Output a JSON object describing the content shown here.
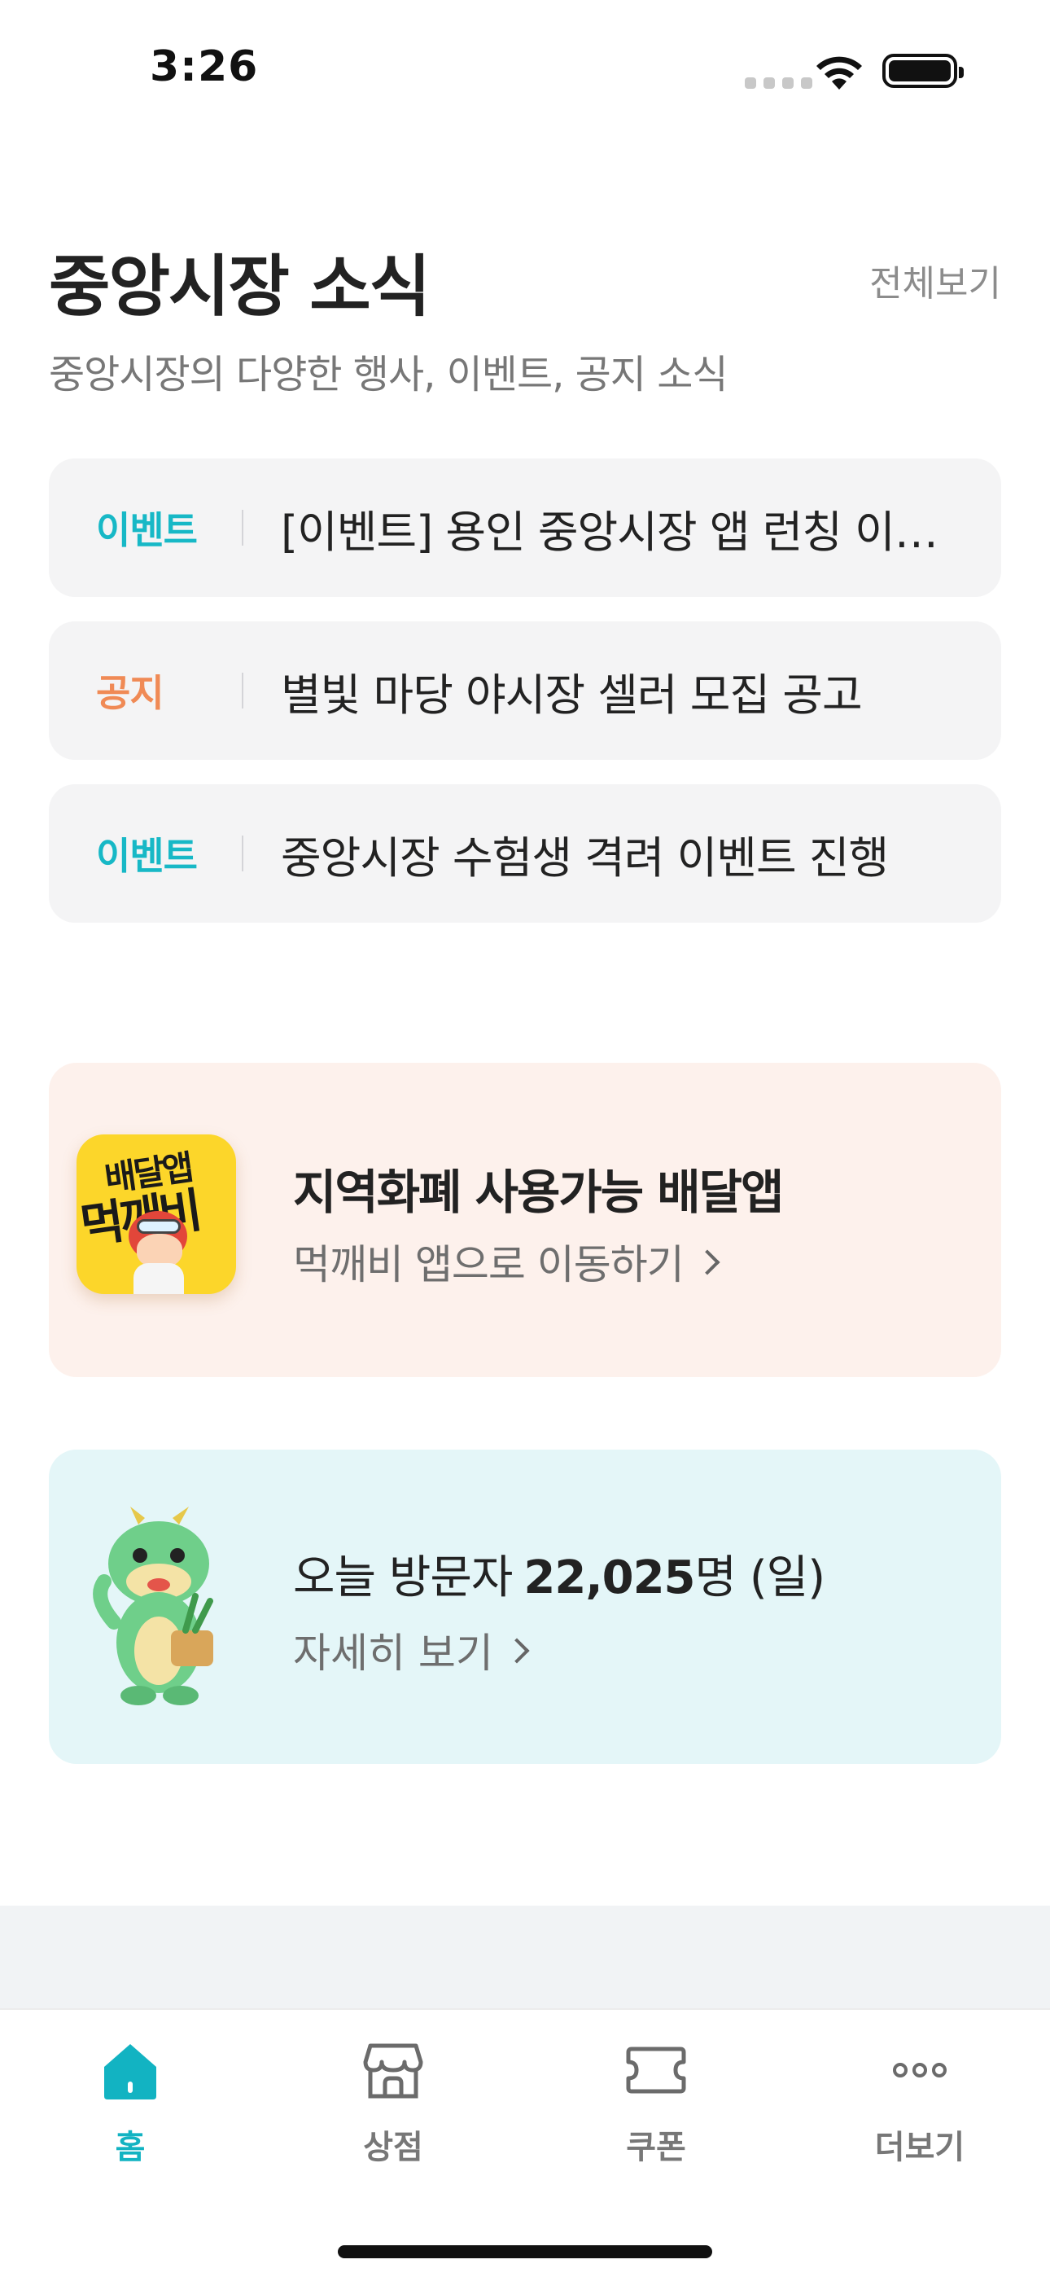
{
  "status_bar": {
    "time": "3:26"
  },
  "news": {
    "title": "중앙시장 소식",
    "view_all": "전체보기",
    "subtitle": "중앙시장의 다양한 행사, 이벤트, 공지 소식",
    "items": [
      {
        "tag": "이벤트",
        "tag_type": "event",
        "text": "[이벤트] 용인 중앙시장 앱 런칭 이벤트"
      },
      {
        "tag": "공지",
        "tag_type": "notice",
        "text": "별빛 마당 야시장 셀러 모집 공고"
      },
      {
        "tag": "이벤트",
        "tag_type": "event",
        "text": "중앙시장 수험생 격려 이벤트 진행"
      }
    ]
  },
  "delivery": {
    "icon_line1": "배달앱",
    "icon_line2": "먹깨비",
    "title": "지역화폐 사용가능 배달앱",
    "link": "먹깨비 앱으로 이동하기"
  },
  "visitor": {
    "label": "오늘 방문자",
    "count": "22,025",
    "unit": "명 (일)",
    "link": "자세히 보기"
  },
  "tabs": [
    {
      "label": "홈",
      "icon": "home-icon",
      "active": true
    },
    {
      "label": "상점",
      "icon": "store-icon",
      "active": false
    },
    {
      "label": "쿠폰",
      "icon": "coupon-icon",
      "active": false
    },
    {
      "label": "더보기",
      "icon": "more-icon",
      "active": false
    }
  ],
  "colors": {
    "accent": "#12b3c2",
    "event_tag": "#17b8c6",
    "notice_tag": "#f08a55",
    "delivery_card_bg": "#fdf1ec",
    "visitor_card_bg": "#e4f6f8"
  }
}
